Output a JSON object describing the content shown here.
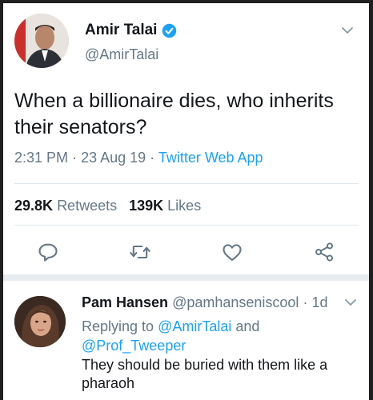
{
  "tweet": {
    "author_name": "Amir Talai",
    "author_handle": "@AmirTalai",
    "text": "When a billionaire dies, who inherits their senators?",
    "time": "2:31 PM",
    "date": "23 Aug 19",
    "source": "Twitter Web App",
    "retweets_count": "29.8K",
    "retweets_label": "Retweets",
    "likes_count": "139K",
    "likes_label": "Likes",
    "icons": [
      "verified-badge-icon",
      "chevron-down-icon",
      "reply-icon",
      "retweet-icon",
      "like-icon",
      "share-icon"
    ]
  },
  "reply": {
    "author_name": "Pam Hansen",
    "author_handle": "@pamhanseniscool",
    "age": "1d",
    "replying_prefix": "Replying to",
    "mention_1": "@AmirTalai",
    "conjunction": "and",
    "mention_2": "@Prof_Tweeper",
    "text": "They should be buried with them like a pharaoh"
  },
  "colors": {
    "accent": "#1da1f2",
    "secondary_text": "#657786",
    "primary_text": "#14171a",
    "divider": "#e1e8ed"
  }
}
